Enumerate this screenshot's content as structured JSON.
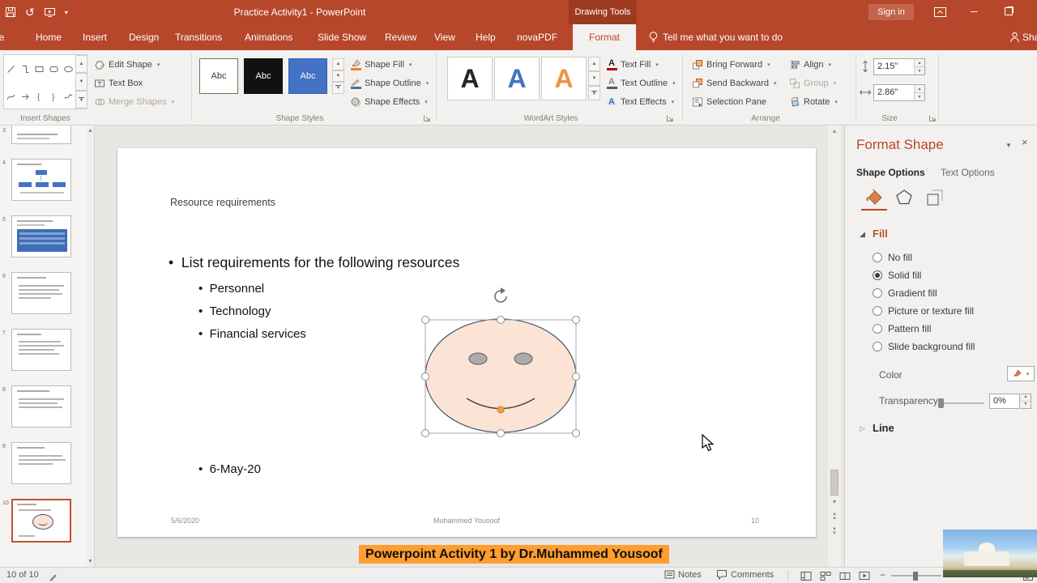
{
  "titlebar": {
    "title": "Practice Activity1 - PowerPoint",
    "contextual_label": "Drawing Tools",
    "sign_in_label": "Sign in"
  },
  "tabs": {
    "file": "File",
    "home": "Home",
    "insert": "Insert",
    "design": "Design",
    "transitions": "Transitions",
    "animations": "Animations",
    "slide_show": "Slide Show",
    "review": "Review",
    "view": "View",
    "help": "Help",
    "novapdf": "novaPDF",
    "format": "Format",
    "tell_me": "Tell me what you want to do",
    "share": "Share"
  },
  "ribbon": {
    "insert_shapes": {
      "label": "Insert Shapes",
      "edit_shape": "Edit Shape",
      "text_box": "Text Box",
      "merge_shapes": "Merge Shapes"
    },
    "shape_styles": {
      "label": "Shape Styles",
      "sample": "Abc",
      "shape_fill": "Shape Fill",
      "shape_outline": "Shape Outline",
      "shape_effects": "Shape Effects"
    },
    "wordart_styles": {
      "label": "WordArt Styles",
      "sample": "A",
      "text_fill": "Text Fill",
      "text_outline": "Text Outline",
      "text_effects": "Text Effects"
    },
    "arrange": {
      "label": "Arrange",
      "bring_forward": "Bring Forward",
      "send_backward": "Send Backward",
      "selection_pane": "Selection Pane",
      "align": "Align",
      "group": "Group",
      "rotate": "Rotate"
    },
    "size": {
      "label": "Size",
      "height_value": "2.15\"",
      "width_value": "2.86\""
    }
  },
  "thumbnails": {
    "numbers": [
      "3",
      "4",
      "5",
      "6",
      "7",
      "8",
      "9",
      "10"
    ]
  },
  "slide": {
    "title": "Resource requirements",
    "bullet_main": "List requirements for the following resources",
    "bullets_sub": [
      "Personnel",
      "Technology",
      "Financial services"
    ],
    "bullet_date": "6-May-20",
    "footer_date": "5/6/2020",
    "footer_author": "Muhammed Yousoof",
    "footer_number": "10"
  },
  "caption": {
    "text": "Powerpoint Activity 1 by Dr.Muhammed Yousoof"
  },
  "format_pane": {
    "title": "Format Shape",
    "tab_shape_options": "Shape Options",
    "tab_text_options": "Text Options",
    "fill": {
      "header": "Fill",
      "options": [
        "No fill",
        "Solid fill",
        "Gradient fill",
        "Picture or texture fill",
        "Pattern fill",
        "Slide background fill"
      ],
      "selected": "Solid fill",
      "color_label": "Color",
      "transparency_label": "Transparency",
      "transparency_value": "0%"
    },
    "line": {
      "header": "Line"
    }
  },
  "statusbar": {
    "slide_indicator": "10 of 10",
    "notes": "Notes",
    "comments": "Comments"
  },
  "colors": {
    "accent": "#B7472A",
    "caption_bg": "#FF9D2E",
    "face_fill": "#FBE3D6"
  }
}
